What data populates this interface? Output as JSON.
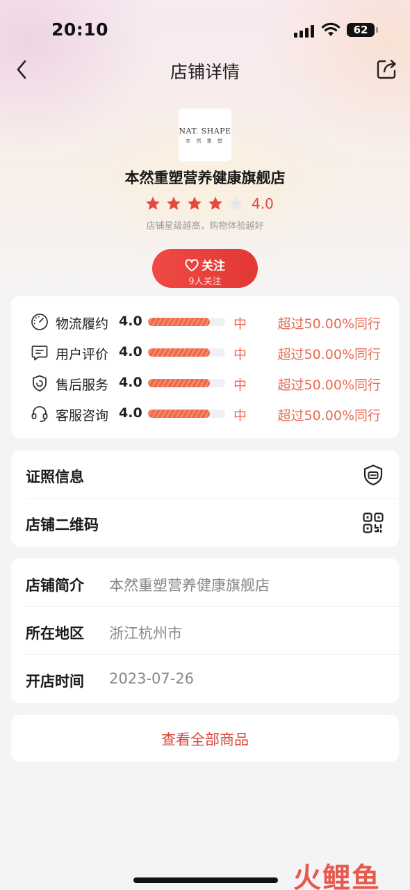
{
  "status_bar": {
    "time": "20:10",
    "battery": "62"
  },
  "nav": {
    "title": "店铺详情",
    "back_icon": "chevron-left-icon",
    "share_icon": "share-icon"
  },
  "shop": {
    "logo_text_main": "NAT. SHAPE",
    "logo_text_sub": "本 然 重 塑",
    "name": "本然重塑营养健康旗舰店",
    "rating": "4.0",
    "rating_stars_filled": 4,
    "rating_stars_total": 5,
    "rating_hint": "店铺星级越高，购物体验越好"
  },
  "follow": {
    "label": "关注",
    "count_text": "9人关注",
    "icon": "heart-icon"
  },
  "scores": [
    {
      "label": "物流履约",
      "value": "4.0",
      "level": "中",
      "compare": "超过50.00%同行",
      "fill": 0.8,
      "icon": "speedometer-icon"
    },
    {
      "label": "用户评价",
      "value": "4.0",
      "level": "中",
      "compare": "超过50.00%同行",
      "fill": 0.8,
      "icon": "comment-icon"
    },
    {
      "label": "售后服务",
      "value": "4.0",
      "level": "中",
      "compare": "超过50.00%同行",
      "fill": 0.8,
      "icon": "shield-icon"
    },
    {
      "label": "客服咨询",
      "value": "4.0",
      "level": "中",
      "compare": "超过50.00%同行",
      "fill": 0.8,
      "icon": "headset-icon"
    }
  ],
  "links": [
    {
      "label": "证照信息",
      "icon": "license-shield-icon"
    },
    {
      "label": "店铺二维码",
      "icon": "qr-code-icon"
    }
  ],
  "info": [
    {
      "label": "店铺简介",
      "value": "本然重塑营养健康旗舰店"
    },
    {
      "label": "所在地区",
      "value": "浙江杭州市"
    },
    {
      "label": "开店时间",
      "value": "2023-07-26"
    }
  ],
  "all_products": {
    "label": "查看全部商品"
  },
  "watermark": "火鲤鱼",
  "colors": {
    "accent": "#e33734",
    "score_text": "#e86a52",
    "star": "#e24a3b",
    "star_empty": "#e6e6e6"
  }
}
